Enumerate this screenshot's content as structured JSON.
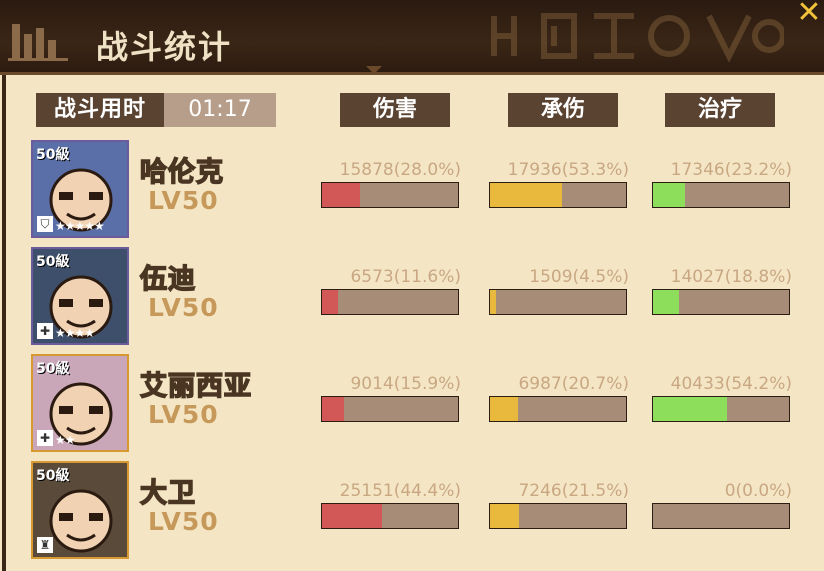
{
  "header": {
    "title": "战斗统计"
  },
  "summary": {
    "time_label": "战斗用时",
    "time_value": "01:17"
  },
  "columns": {
    "damage": "伤害",
    "taken": "承伤",
    "heal": "治疗"
  },
  "colors": {
    "damage": "#d25757",
    "taken": "#e9b93e",
    "heal": "#8dde5a"
  },
  "heroes": [
    {
      "name": "哈伦克",
      "level_text": "LV50",
      "badge": "50級",
      "stars": "★★★★★",
      "class_icon": "shield-icon",
      "damage": {
        "text": "15878(28.0%)",
        "pct": 0.28
      },
      "taken": {
        "text": "17936(53.3%)",
        "pct": 0.533
      },
      "heal": {
        "text": "17346(23.2%)",
        "pct": 0.232
      }
    },
    {
      "name": "伍迪",
      "level_text": "LV50",
      "badge": "50級",
      "stars": "★★★★",
      "class_icon": "cross-icon",
      "damage": {
        "text": "6573(11.6%)",
        "pct": 0.116
      },
      "taken": {
        "text": "1509(4.5%)",
        "pct": 0.045
      },
      "heal": {
        "text": "14027(18.8%)",
        "pct": 0.188
      }
    },
    {
      "name": "艾丽西亚",
      "level_text": "LV50",
      "badge": "50級",
      "stars": "★★",
      "class_icon": "cross-icon",
      "damage": {
        "text": "9014(15.9%)",
        "pct": 0.159
      },
      "taken": {
        "text": "6987(20.7%)",
        "pct": 0.207
      },
      "heal": {
        "text": "40433(54.2%)",
        "pct": 0.542
      }
    },
    {
      "name": "大卫",
      "level_text": "LV50",
      "badge": "50級",
      "stars": "",
      "class_icon": "sword-icon",
      "damage": {
        "text": "25151(44.4%)",
        "pct": 0.444
      },
      "taken": {
        "text": "7246(21.5%)",
        "pct": 0.215
      },
      "heal": {
        "text": "0(0.0%)",
        "pct": 0.0
      }
    }
  ]
}
